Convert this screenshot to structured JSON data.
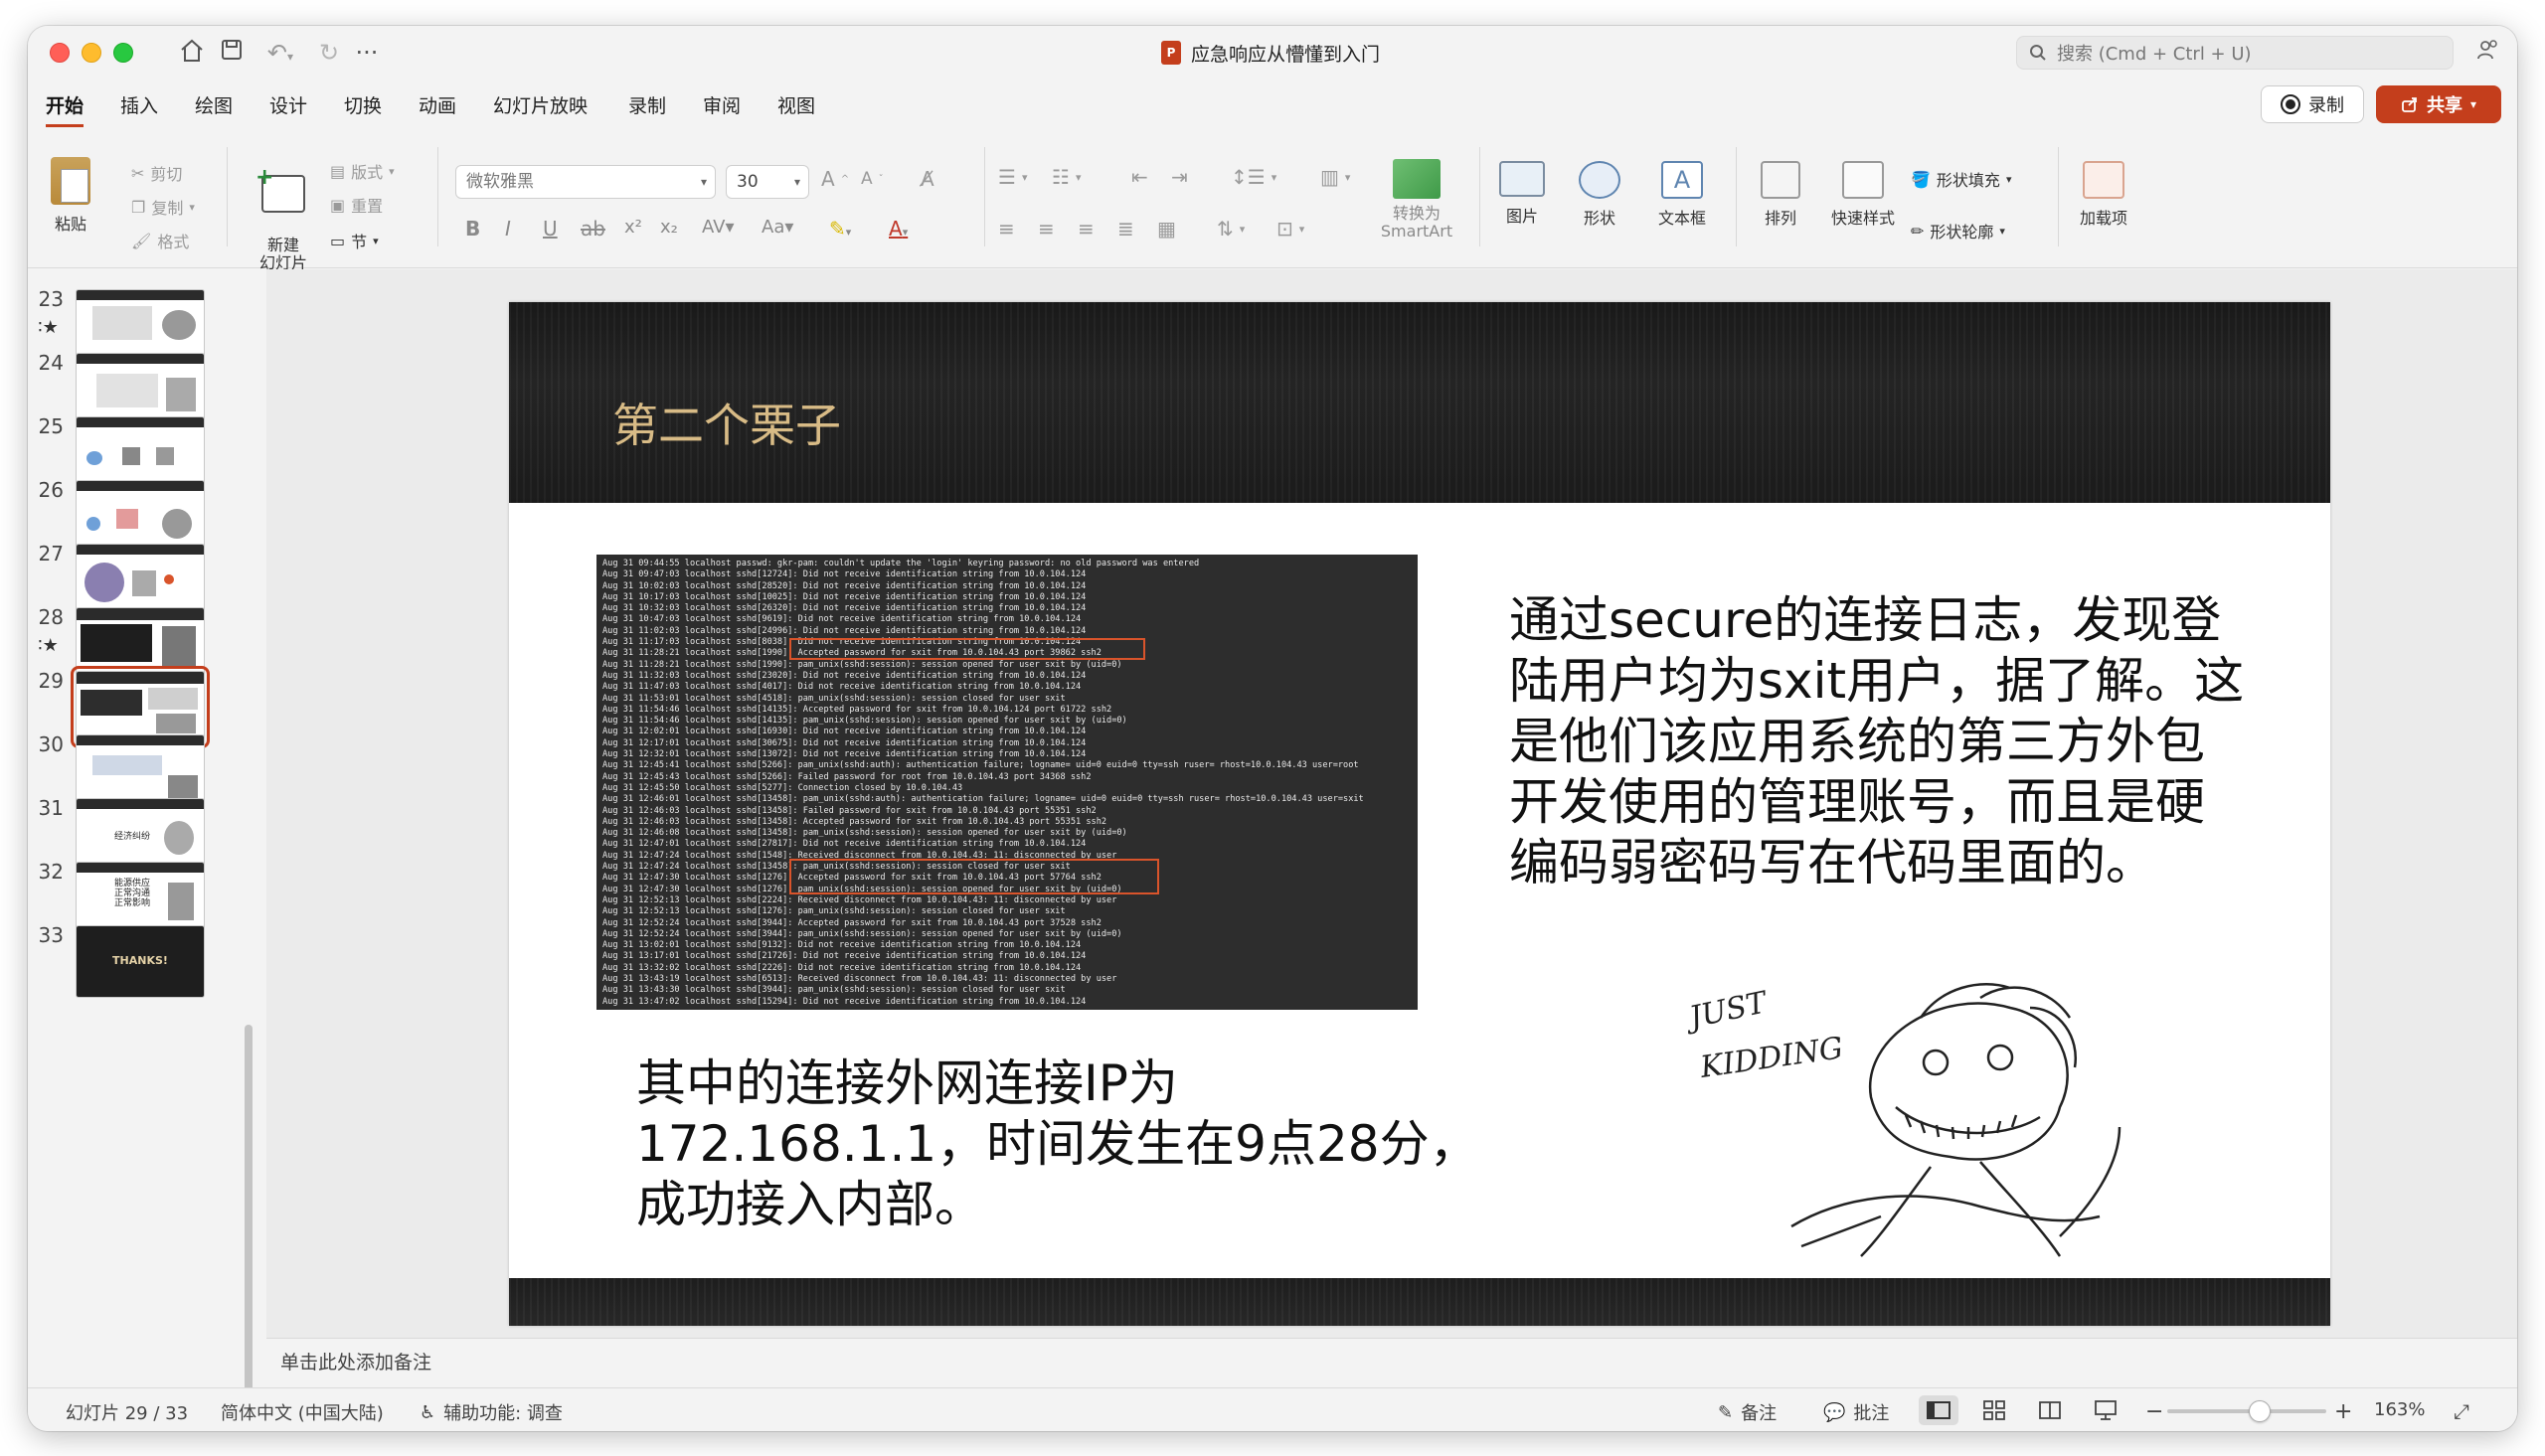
{
  "window": {
    "doc_title": "应急响应从懵懂到入门",
    "app_badge": "P",
    "search_placeholder": "搜索 (Cmd + Ctrl + U)"
  },
  "titlebar_icons": [
    "home-icon",
    "save-icon",
    "undo-icon",
    "redo-icon",
    "more-icon"
  ],
  "tabs": [
    {
      "label": "开始",
      "active": true
    },
    {
      "label": "插入"
    },
    {
      "label": "绘图"
    },
    {
      "label": "设计"
    },
    {
      "label": "切换"
    },
    {
      "label": "动画"
    },
    {
      "label": "幻灯片放映"
    },
    {
      "label": "录制"
    },
    {
      "label": "审阅"
    },
    {
      "label": "视图"
    }
  ],
  "actions": {
    "record": "录制",
    "share": "共享"
  },
  "ribbon": {
    "paste": "粘贴",
    "cut": "剪切",
    "copy": "复制",
    "format": "格式",
    "new_slide": "新建\n幻灯片",
    "layout": "版式",
    "reset": "重置",
    "section": "节",
    "font_name": "微软雅黑",
    "font_size": "30",
    "convert_smartart_1": "转换为",
    "convert_smartart_2": "SmartArt",
    "picture": "图片",
    "shape": "形状",
    "textbox": "文本框",
    "arrange": "排列",
    "quick_styles": "快速样式",
    "shape_fill": "形状填充",
    "shape_outline": "形状轮廓",
    "addins": "加载项"
  },
  "thumbnails": [
    {
      "num": "23",
      "star": true
    },
    {
      "num": "24",
      "star": false
    },
    {
      "num": "25",
      "star": false
    },
    {
      "num": "26",
      "star": false
    },
    {
      "num": "27",
      "star": false
    },
    {
      "num": "28",
      "star": true
    },
    {
      "num": "29",
      "star": false,
      "selected": true
    },
    {
      "num": "30",
      "star": false
    },
    {
      "num": "31",
      "star": false,
      "label": "经济纠纷"
    },
    {
      "num": "32",
      "star": false,
      "label": "能源供应\n正常沟通\n正常影响"
    },
    {
      "num": "33",
      "star": false,
      "label": "THANKS!"
    }
  ],
  "slide": {
    "title": "第二个栗子",
    "right_text": "通过secure的连接日志，发现登陆用户均为sxit用户，据了解。这是他们该应用系统的第三方外包开发使用的管理账号，而且是硬编码弱密码写在代码里面的。",
    "left_text": "其中的连接外网连接IP为172.168.1.1，时间发生在9点28分，成功接入内部。",
    "cartoon_text": "JUST KIDDING",
    "log_lines": [
      "Aug 31 09:44:55 localhost passwd: gkr-pam: couldn't update the 'login' keyring password: no old password was entered",
      "Aug 31 09:47:03 localhost sshd[12724]: Did not receive identification string from 10.0.104.124",
      "Aug 31 10:02:03 localhost sshd[28520]: Did not receive identification string from 10.0.104.124",
      "Aug 31 10:17:03 localhost sshd[10025]: Did not receive identification string from 10.0.104.124",
      "Aug 31 10:32:03 localhost sshd[26320]: Did not receive identification string from 10.0.104.124",
      "Aug 31 10:47:03 localhost sshd[9619]: Did not receive identification string from 10.0.104.124",
      "Aug 31 11:02:03 localhost sshd[24996]: Did not receive identification string from 10.0.104.124",
      "Aug 31 11:17:03 localhost sshd[8038]: Did not receive identification string from 10.0.104.124",
      "Aug 31 11:28:21 localhost sshd[1990]: Accepted password for sxit from 10.0.104.43 port 39862 ssh2",
      "Aug 31 11:28:21 localhost sshd[1990]: pam_unix(sshd:session): session opened for user sxit by (uid=0)",
      "Aug 31 11:32:03 localhost sshd[23020]: Did not receive identification string from 10.0.104.124",
      "Aug 31 11:47:03 localhost sshd[4017]: Did not receive identification string from 10.0.104.124",
      "Aug 31 11:53:01 localhost sshd[4518]: pam_unix(sshd:session): session closed for user sxit",
      "Aug 31 11:54:46 localhost sshd[14135]: Accepted password for sxit from 10.0.104.124 port 61722 ssh2",
      "Aug 31 11:54:46 localhost sshd[14135]: pam_unix(sshd:session): session opened for user sxit by (uid=0)",
      "Aug 31 12:02:01 localhost sshd[16930]: Did not receive identification string from 10.0.104.124",
      "Aug 31 12:17:01 localhost sshd[30675]: Did not receive identification string from 10.0.104.124",
      "Aug 31 12:32:01 localhost sshd[13072]: Did not receive identification string from 10.0.104.124",
      "Aug 31 12:45:41 localhost sshd[5266]: pam_unix(sshd:auth): authentication failure; logname= uid=0 euid=0 tty=ssh ruser= rhost=10.0.104.43  user=root",
      "Aug 31 12:45:43 localhost sshd[5266]: Failed password for root from 10.0.104.43 port 34368 ssh2",
      "Aug 31 12:45:50 localhost sshd[5277]: Connection closed by 10.0.104.43",
      "Aug 31 12:46:01 localhost sshd[13458]: pam_unix(sshd:auth): authentication failure; logname= uid=0 euid=0 tty=ssh ruser= rhost=10.0.104.43  user=sxit",
      "Aug 31 12:46:03 localhost sshd[13458]: Failed password for sxit from 10.0.104.43 port 55351 ssh2",
      "Aug 31 12:46:03 localhost sshd[13458]: Accepted password for sxit from 10.0.104.43 port 55351 ssh2",
      "Aug 31 12:46:08 localhost sshd[13458]: pam_unix(sshd:session): session opened for user sxit by (uid=0)",
      "Aug 31 12:47:01 localhost sshd[27817]: Did not receive identification string from 10.0.104.124",
      "Aug 31 12:47:24 localhost sshd[1548]: Received disconnect from 10.0.104.43: 11: disconnected by user",
      "Aug 31 12:47:24 localhost sshd[13458]: pam_unix(sshd:session): session closed for user sxit",
      "Aug 31 12:47:30 localhost sshd[1276]: Accepted password for sxit from 10.0.104.43 port 57764 ssh2",
      "Aug 31 12:47:30 localhost sshd[1276]: pam_unix(sshd:session): session opened for user sxit by (uid=0)",
      "Aug 31 12:52:13 localhost sshd[2224]: Received disconnect from 10.0.104.43: 11: disconnected by user",
      "Aug 31 12:52:13 localhost sshd[1276]: pam_unix(sshd:session): session closed for user sxit",
      "Aug 31 12:52:24 localhost sshd[3944]: Accepted password for sxit from 10.0.104.43 port 37528 ssh2",
      "Aug 31 12:52:24 localhost sshd[3944]: pam_unix(sshd:session): session opened for user sxit by (uid=0)",
      "Aug 31 13:02:01 localhost sshd[9132]: Did not receive identification string from 10.0.104.124",
      "Aug 31 13:17:01 localhost sshd[21726]: Did not receive identification string from 10.0.104.124",
      "Aug 31 13:32:02 localhost sshd[2226]: Did not receive identification string from 10.0.104.124",
      "Aug 31 13:43:19 localhost sshd[6513]: Received disconnect from 10.0.104.43: 11: disconnected by user",
      "Aug 31 13:43:30 localhost sshd[3944]: pam_unix(sshd:session): session closed for user sxit",
      "Aug 31 13:47:02 localhost sshd[15294]: Did not receive identification string from 10.0.104.124"
    ]
  },
  "notes_placeholder": "单击此处添加备注",
  "status": {
    "slide_counter": "幻灯片 29 / 33",
    "language": "简体中文 (中国大陆)",
    "accessibility": "辅助功能: 调查",
    "notes": "备注",
    "comments": "批注",
    "zoom": "163%",
    "zoom_level_percent": 163
  },
  "colors": {
    "accent": "#c43e1c",
    "slide_title": "#d8bb86",
    "highlight_box": "#d9542b"
  }
}
